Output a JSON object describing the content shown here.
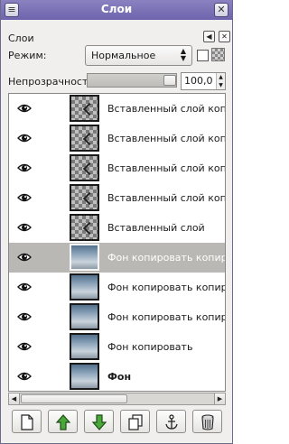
{
  "window": {
    "title": "Слои"
  },
  "dock": {
    "title": "Слои"
  },
  "mode": {
    "label": "Режим:",
    "value": "Нормальное"
  },
  "opacity": {
    "label": "Непрозрачность:",
    "value": "100,0",
    "level_percent": 100
  },
  "layers": [
    {
      "name": "Вставленный слой копирова",
      "thumb": "checker",
      "selected": false,
      "bold": false
    },
    {
      "name": "Вставленный слой копиров",
      "thumb": "checker",
      "selected": false,
      "bold": false
    },
    {
      "name": "Вставленный слой копиров",
      "thumb": "checker",
      "selected": false,
      "bold": false
    },
    {
      "name": "Вставленный слой копиров",
      "thumb": "checker",
      "selected": false,
      "bold": false
    },
    {
      "name": "Вставленный слой",
      "thumb": "checker",
      "selected": false,
      "bold": false
    },
    {
      "name": "Фон копировать копирова",
      "thumb": "sky",
      "selected": true,
      "bold": false
    },
    {
      "name": "Фон копировать копиров",
      "thumb": "sky",
      "selected": false,
      "bold": false
    },
    {
      "name": "Фон копировать копиров",
      "thumb": "sky",
      "selected": false,
      "bold": false
    },
    {
      "name": "Фон копировать",
      "thumb": "sky",
      "selected": false,
      "bold": false
    },
    {
      "name": "Фон",
      "thumb": "sky",
      "selected": false,
      "bold": true
    }
  ],
  "toolbar": {
    "buttons": [
      {
        "icon": "new-layer-icon"
      },
      {
        "icon": "raise-layer-icon"
      },
      {
        "icon": "lower-layer-icon"
      },
      {
        "icon": "duplicate-layer-icon"
      },
      {
        "icon": "anchor-layer-icon"
      },
      {
        "icon": "delete-layer-icon"
      }
    ]
  },
  "colors": {
    "titlebar": "#6d64ad",
    "selected_row": "#b9b8b4",
    "arrow_green": "#3a8a2c"
  }
}
